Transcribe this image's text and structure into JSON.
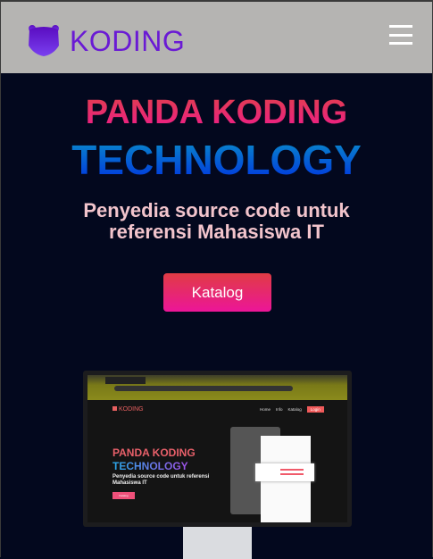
{
  "nav": {
    "brand": "KODING",
    "menu_icon": "hamburger-icon"
  },
  "hero": {
    "title_line1": "PANDA KODING",
    "title_line2": "TECHNOLOGY",
    "subtitle": "Penyedia source code untuk referensi Mahasiswa IT",
    "cta": "Katalog"
  },
  "mockup": {
    "brand": "KODING",
    "nav": [
      "Home",
      "Info",
      "Katalog"
    ],
    "login": "Login",
    "title_line1": "PANDA KODING",
    "title_line2": "TECHNOLOGY",
    "subtitle": "Penyedia source code untuk referensi Mahasiswa IT",
    "cta": "Katalog"
  },
  "colors": {
    "navbar": "#b5b4b2",
    "background": "#03081e",
    "brand": "#6a1ad4",
    "cta_top": "#e03c44",
    "cta_bottom": "#ec1599"
  }
}
